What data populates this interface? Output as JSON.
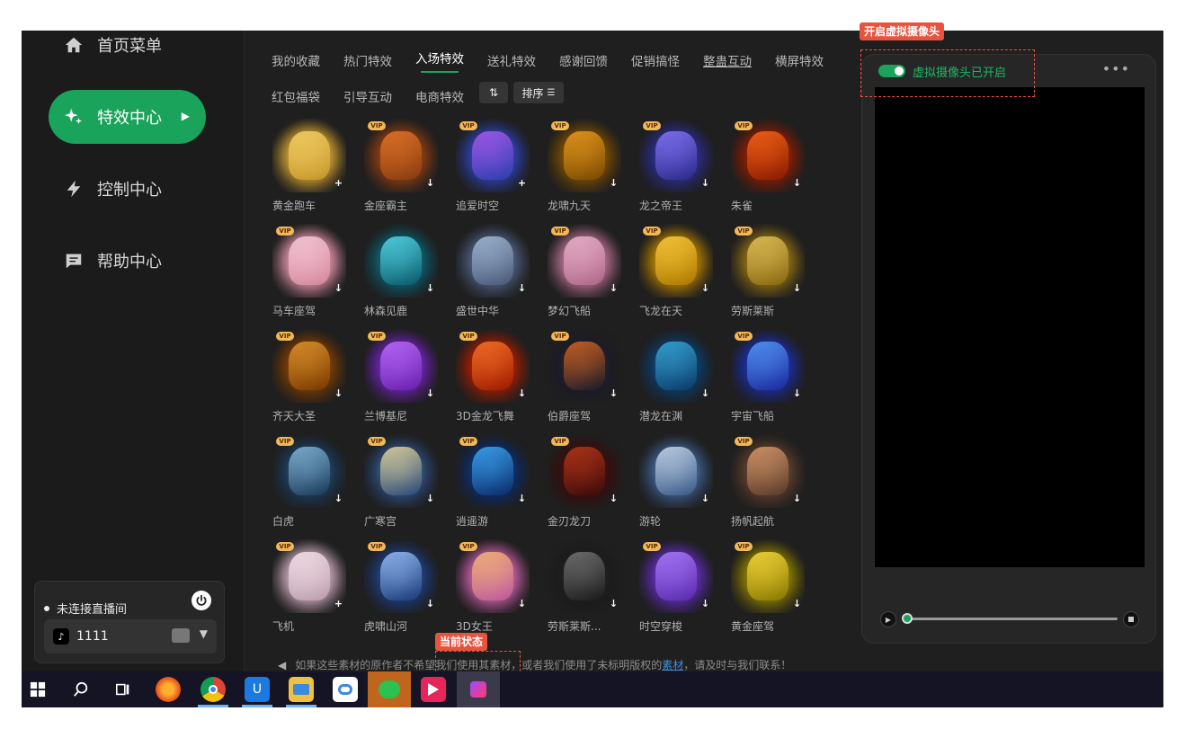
{
  "sidebar": {
    "items": [
      {
        "label": "首页菜单",
        "icon": "home-icon"
      },
      {
        "label": "特效中心",
        "icon": "sparkle-icon",
        "active": true
      },
      {
        "label": "控制中心",
        "icon": "lightning-icon"
      },
      {
        "label": "帮助中心",
        "icon": "chat-icon"
      }
    ],
    "live_status": "未连接直播间",
    "account": "1111"
  },
  "tabs": {
    "row1": [
      "我的收藏",
      "热门特效",
      "入场特效",
      "送礼特效",
      "感谢回馈",
      "促销搞怪",
      "整蛊互动",
      "横屏特效"
    ],
    "row2": [
      "红包福袋",
      "引导互动",
      "电商特效"
    ],
    "active": "入场特效",
    "sort_label": "排序",
    "sort_icon_label": "⇅"
  },
  "grid": {
    "items": [
      {
        "name": "黄金跑车",
        "vip": false,
        "action": "+",
        "colors": [
          "#c99a2e",
          "#f7d46a"
        ]
      },
      {
        "name": "金座霸主",
        "vip": true,
        "action": "↓",
        "colors": [
          "#8a3b10",
          "#e8792a"
        ]
      },
      {
        "name": "追爱时空",
        "vip": true,
        "action": "+",
        "colors": [
          "#2a3fae",
          "#b25cf2"
        ]
      },
      {
        "name": "龙啸九天",
        "vip": true,
        "action": "↓",
        "colors": [
          "#7a4a00",
          "#f0a020"
        ]
      },
      {
        "name": "龙之帝王",
        "vip": true,
        "action": "↓",
        "colors": [
          "#2a2a8a",
          "#8a7aff"
        ]
      },
      {
        "name": "朱雀",
        "vip": true,
        "action": "↓",
        "colors": [
          "#8a1a00",
          "#ff6a1a"
        ]
      },
      {
        "name": "马车座驾",
        "vip": true,
        "action": "↓",
        "colors": [
          "#d88aa0",
          "#f7cfdc"
        ]
      },
      {
        "name": "林森见鹿",
        "vip": false,
        "action": "↓",
        "colors": [
          "#0a5a6a",
          "#5ae0f0"
        ]
      },
      {
        "name": "盛世中华",
        "vip": false,
        "action": "↓",
        "colors": [
          "#4a5a7a",
          "#a8c0dc"
        ]
      },
      {
        "name": "梦幻飞船",
        "vip": true,
        "action": "↓",
        "colors": [
          "#b06a8a",
          "#f0b8d0"
        ]
      },
      {
        "name": "飞龙在天",
        "vip": true,
        "action": "↓",
        "colors": [
          "#b07a00",
          "#ffd040"
        ]
      },
      {
        "name": "劳斯莱斯",
        "vip": true,
        "action": "↓",
        "colors": [
          "#8a6a10",
          "#e8c860"
        ]
      },
      {
        "name": "齐天大圣",
        "vip": true,
        "action": "↓",
        "colors": [
          "#7a3a00",
          "#e89a30"
        ]
      },
      {
        "name": "兰博基尼",
        "vip": true,
        "action": "↓",
        "colors": [
          "#6a20b0",
          "#c070ff"
        ]
      },
      {
        "name": "3D金龙飞舞",
        "vip": true,
        "action": "↓",
        "colors": [
          "#a01a00",
          "#ff7a2a"
        ]
      },
      {
        "name": "伯爵座驾",
        "vip": true,
        "action": "↓",
        "colors": [
          "#1a1a2a",
          "#e06a20"
        ]
      },
      {
        "name": "潜龙在渊",
        "vip": false,
        "action": "↓",
        "colors": [
          "#0a3a6a",
          "#3ab0e0"
        ]
      },
      {
        "name": "宇宙飞船",
        "vip": true,
        "action": "↓",
        "colors": [
          "#1a2aa0",
          "#5aa0ff"
        ]
      },
      {
        "name": "白虎",
        "vip": true,
        "action": "↓",
        "colors": [
          "#1a3a5a",
          "#8ac0e0"
        ]
      },
      {
        "name": "广寒宫",
        "vip": true,
        "action": "↓",
        "colors": [
          "#2a4a7a",
          "#f0e0a0"
        ]
      },
      {
        "name": "逍遥游",
        "vip": true,
        "action": "↓",
        "colors": [
          "#0a2a6a",
          "#40b0ff"
        ]
      },
      {
        "name": "金刃龙刀",
        "vip": true,
        "action": "↓",
        "colors": [
          "#3a0a0a",
          "#c03a1a"
        ]
      },
      {
        "name": "游轮",
        "vip": false,
        "action": "↓",
        "colors": [
          "#3a5a8a",
          "#d0e0f0"
        ]
      },
      {
        "name": "扬帆起航",
        "vip": true,
        "action": "↓",
        "colors": [
          "#5a3a2a",
          "#e0a070"
        ]
      },
      {
        "name": "飞机",
        "vip": true,
        "action": "+",
        "colors": [
          "#c0a0b0",
          "#f8e8ee"
        ]
      },
      {
        "name": "虎啸山河",
        "vip": true,
        "action": "↓",
        "colors": [
          "#1a3a7a",
          "#a0c8ff"
        ]
      },
      {
        "name": "3D女王",
        "vip": true,
        "action": "↓",
        "colors": [
          "#c05aa0",
          "#f8c070"
        ]
      },
      {
        "name": "劳斯莱斯...",
        "vip": false,
        "action": "↓",
        "colors": [
          "#1a1a1a",
          "#7a7a7a"
        ]
      },
      {
        "name": "时空穿梭",
        "vip": true,
        "action": "↓",
        "colors": [
          "#5a2ab0",
          "#b080ff"
        ]
      },
      {
        "name": "黄金座驾",
        "vip": true,
        "action": "↓",
        "colors": [
          "#8a7a00",
          "#ffe040"
        ]
      }
    ]
  },
  "notice": {
    "text_before": "如果这些素材的原作者不希望我们使用其素材，或者我们使用了未标明版权的",
    "link": "素材",
    "text_after": "，请及时与我们联系！"
  },
  "preview": {
    "camera_status": "虚拟摄像头已开启",
    "more": "•••"
  },
  "callouts": {
    "camera": "开启虚拟摄像头",
    "state": "当前状态"
  },
  "taskbar": {
    "icons": [
      "windows-start-icon",
      "search-icon",
      "task-view-icon",
      "firefox-icon",
      "chrome-icon",
      "app-icon",
      "file-explorer-icon",
      "baidu-netdisk-icon",
      "wechat-icon",
      "app-pink-icon",
      "app-active-icon"
    ]
  }
}
